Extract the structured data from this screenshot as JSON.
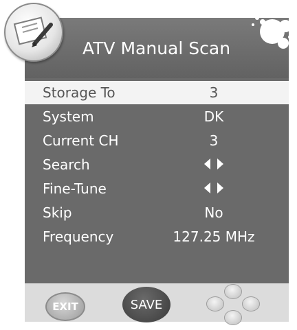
{
  "header": {
    "title": "ATV Manual Scan",
    "tool_icon": "tools-icon",
    "decoration_icon": "bubbles-icon"
  },
  "rows": [
    {
      "label": "Storage To",
      "value": "3",
      "selected": true
    },
    {
      "label": "System",
      "value": "DK"
    },
    {
      "label": "Current CH",
      "value": "3"
    },
    {
      "label": "Search",
      "value": "",
      "control": "left-right-arrows"
    },
    {
      "label": "Fine-Tune",
      "value": "",
      "control": "left-right-arrows"
    },
    {
      "label": "Skip",
      "value": "No"
    },
    {
      "label": "Frequency",
      "value": "127.25 MHz"
    }
  ],
  "footer": {
    "exit_label": "EXIT",
    "save_label": "SAVE",
    "nav_icon": "direction-pad-icon"
  },
  "colors": {
    "panel": "#6a6a6a",
    "selected_row": "#f3f3f3",
    "text": "#ffffff"
  }
}
